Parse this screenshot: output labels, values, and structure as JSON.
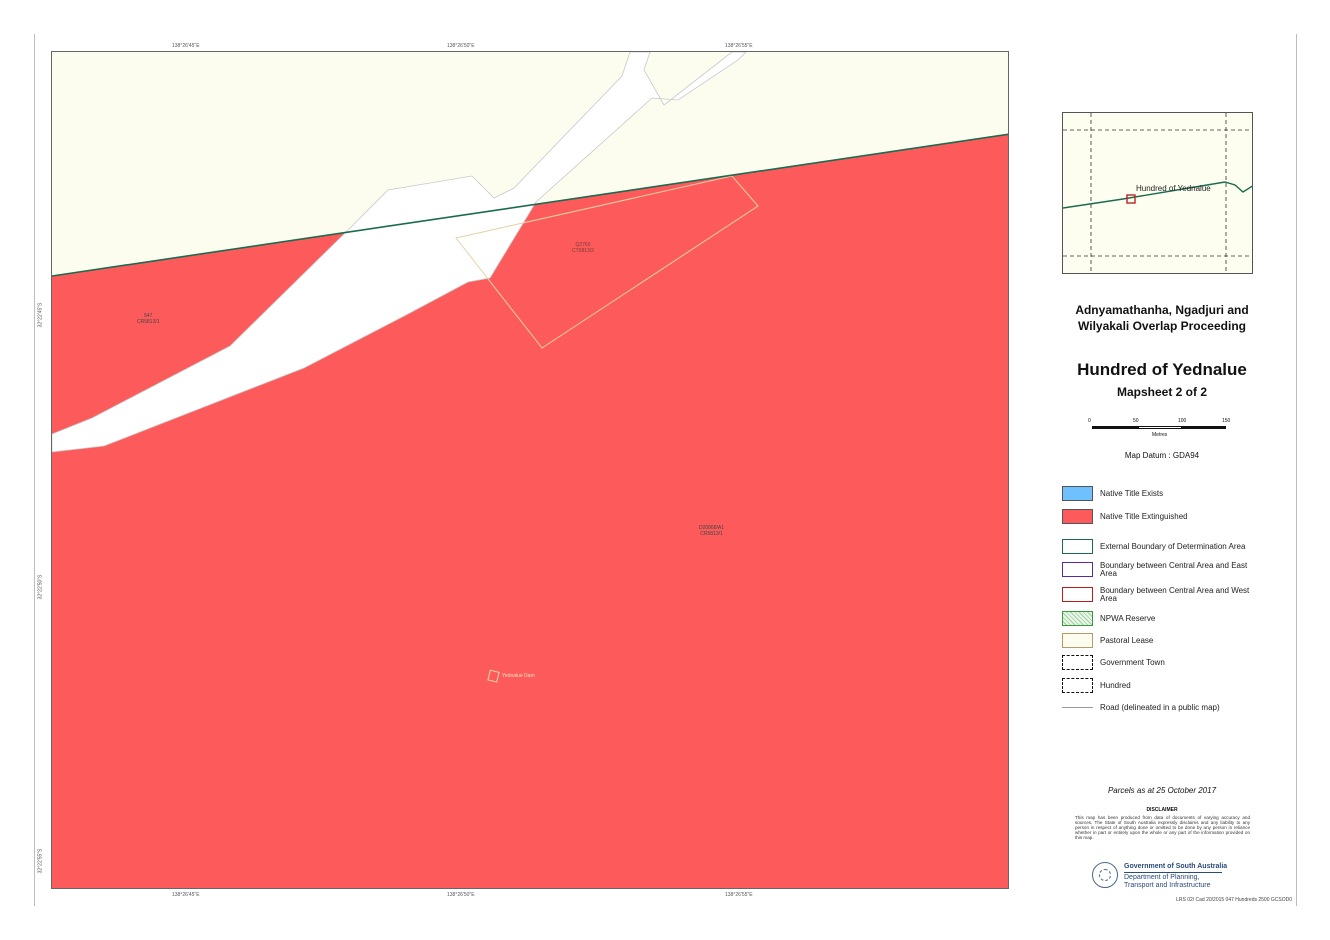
{
  "map": {
    "top_coords": [
      "138°26'45\"E",
      "138°26'50\"E",
      "138°26'55\"E"
    ],
    "bottom_coords": [
      "138°26'45\"E",
      "138°26'50\"E",
      "138°26'55\"E"
    ],
    "left_coords": [
      "32°22'45\"S",
      "32°22'50\"S",
      "32°22'55\"S"
    ],
    "right_coords": [
      "32°22'45\"S",
      "32°22'50\"S",
      "32°22'55\"S"
    ],
    "parcel_labels": [
      {
        "line1": "547",
        "line2": "CR5813/1"
      },
      {
        "line1": "Q2760",
        "line2": "CT5813/2"
      },
      {
        "line1": "D20868/A1",
        "line2": "CR5813/1"
      },
      {
        "line1": "",
        "line2": "Yednalue Dam"
      }
    ],
    "colors": {
      "extinguished": "#fd5b5b",
      "exists": "#6ec0ff",
      "pastoral_background": "#fdfdef",
      "external_boundary": "#1a6b50"
    }
  },
  "inset": {
    "label": "Hundred of Yednalue"
  },
  "title": {
    "proceeding": "Adnyamathanha, Ngadjuri and Wilyakali Overlap Proceeding",
    "hundred": "Hundred of Yednalue",
    "mapsheet": "Mapsheet 2 of 2"
  },
  "scale": {
    "ticks": [
      "0",
      "50",
      "100",
      "150"
    ],
    "unit": "Metres"
  },
  "datum": "Map Datum : GDA94",
  "legend": [
    {
      "label": "Native Title Exists",
      "icon": "solid-blue-swatch"
    },
    {
      "label": "Native Title Extinguished",
      "icon": "solid-red-swatch"
    },
    {
      "label": "External Boundary of Determination Area",
      "icon": "green-outline-swatch"
    },
    {
      "label": "Boundary between Central Area and East Area",
      "icon": "purple-outline-swatch"
    },
    {
      "label": "Boundary between Central Area and West Area",
      "icon": "red-outline-swatch"
    },
    {
      "label": "NPWA Reserve",
      "icon": "green-hatched-swatch"
    },
    {
      "label": "Pastoral Lease",
      "icon": "tan-outline-swatch"
    },
    {
      "label": "Government Town",
      "icon": "dash-dot-outline-swatch"
    },
    {
      "label": "Hundred",
      "icon": "dashed-outline-swatch"
    },
    {
      "label": "Road (delineated in a public map)",
      "icon": "road-line-swatch"
    }
  ],
  "parcels_note": "Parcels as at 25 October 2017",
  "disclaimer": {
    "title": "DISCLAIMER",
    "text": "This map has been produced from data of documents of varying accuracy and sources. The State of South Australia expressly disclaims and any liability to any person in respect of anything done or omitted to be done by any person in reliance whether in part or entirely upon the whole or any part of the information provided on this map."
  },
  "government": {
    "name": "Government of South Australia",
    "dept_line1": "Department of Planning,",
    "dept_line2": "Transport and Infrastructure",
    "emblem_icon": "state-emblem-icon"
  },
  "reference": "LRS 02/ Cad 20/2015 047 Hundreds 2500 GCSOD0"
}
